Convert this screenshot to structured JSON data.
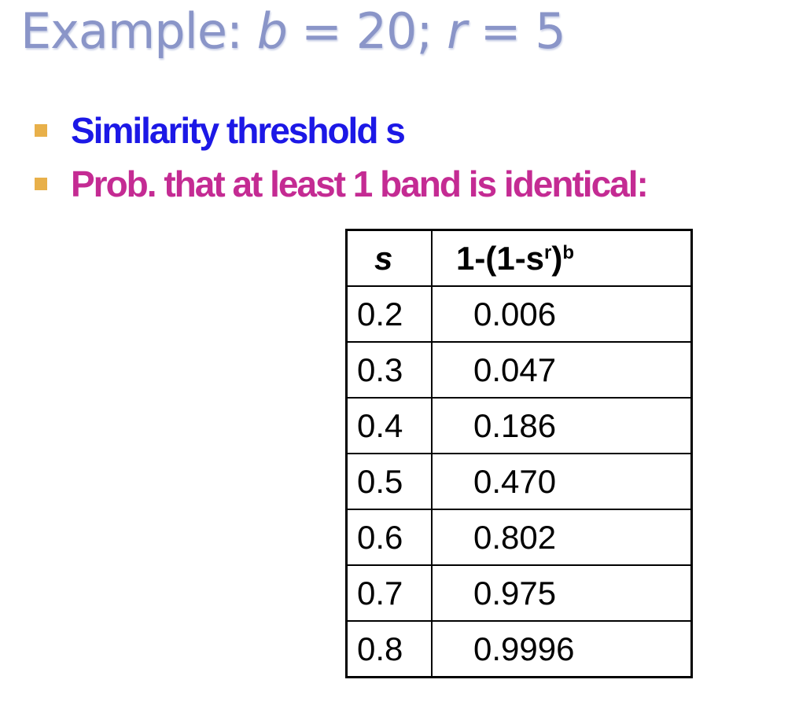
{
  "title": {
    "prefix": "Example:",
    "b_var": "b",
    "b_eq": "= 20;",
    "r_var": "r",
    "r_eq": "= 5"
  },
  "bullets": [
    {
      "text": "Similarity threshold s",
      "color": "#1c18e6"
    },
    {
      "text": "Prob. that at least 1 band is identical:",
      "color": "#c42b93"
    }
  ],
  "table": {
    "headers": {
      "s": "s",
      "formula_main": "1-(1-s",
      "formula_sup_r": "r",
      "formula_close": ")",
      "formula_sup_b": "b"
    },
    "rows": [
      {
        "s": "0.2",
        "p": "0.006"
      },
      {
        "s": "0.3",
        "p": "0.047"
      },
      {
        "s": "0.4",
        "p": "0.186"
      },
      {
        "s": "0.5",
        "p": "0.470"
      },
      {
        "s": "0.6",
        "p": "0.802"
      },
      {
        "s": "0.7",
        "p": "0.975"
      },
      {
        "s": "0.8",
        "p": "0.9996"
      }
    ]
  },
  "colors": {
    "title": "#8a95c8",
    "bullet_marker": "#e8b04a"
  }
}
